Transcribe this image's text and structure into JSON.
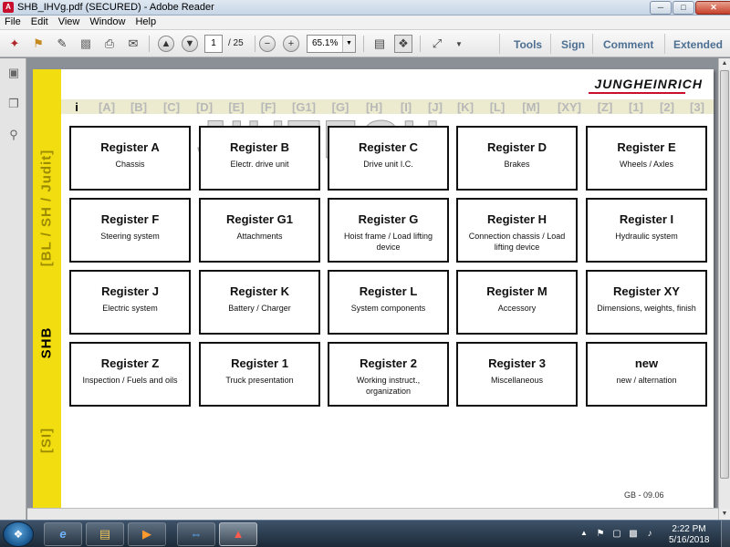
{
  "window": {
    "title": "SHB_IHVg.pdf (SECURED) - Adobe Reader",
    "controls": [
      "minimize",
      "maximize",
      "close"
    ]
  },
  "menu": [
    "File",
    "Edit",
    "View",
    "Window",
    "Help"
  ],
  "toolbar": {
    "page_current": "1",
    "page_total": "/ 25",
    "zoom": "65.1%",
    "links": [
      "Tools",
      "Sign",
      "Comment",
      "Extended"
    ]
  },
  "document": {
    "brand": "JUNGHEINRICH",
    "watermark": "JIUTECH",
    "side_labels": [
      "[BL / SH / Judit]",
      "SHB",
      "[SI]"
    ],
    "index_tabs": [
      "i",
      "[A]",
      "[B]",
      "[C]",
      "[D]",
      "[E]",
      "[F]",
      "[G1]",
      "[G]",
      "[H]",
      "[I]",
      "[J]",
      "[K]",
      "[L]",
      "[M]",
      "[XY]",
      "[Z]",
      "[1]",
      "[2]",
      "[3]"
    ],
    "registers": [
      {
        "name": "Register A",
        "desc": "Chassis"
      },
      {
        "name": "Register B",
        "desc": "Electr. drive unit"
      },
      {
        "name": "Register C",
        "desc": "Drive unit I.C."
      },
      {
        "name": "Register D",
        "desc": "Brakes"
      },
      {
        "name": "Register E",
        "desc": "Wheels / Axles"
      },
      {
        "name": "Register F",
        "desc": "Steering system"
      },
      {
        "name": "Register G1",
        "desc": "Attachments"
      },
      {
        "name": "Register G",
        "desc": "Hoist frame / Load lifting device"
      },
      {
        "name": "Register H",
        "desc": "Connection chassis / Load lifting device"
      },
      {
        "name": "Register I",
        "desc": "Hydraulic system"
      },
      {
        "name": "Register J",
        "desc": "Electric system"
      },
      {
        "name": "Register K",
        "desc": "Battery / Charger"
      },
      {
        "name": "Register L",
        "desc": "System components"
      },
      {
        "name": "Register M",
        "desc": "Accessory"
      },
      {
        "name": "Register XY",
        "desc": "Dimensions, weights, finish"
      },
      {
        "name": "Register Z",
        "desc": "Inspection / Fuels and oils"
      },
      {
        "name": "Register 1",
        "desc": "Truck presentation"
      },
      {
        "name": "Register 2",
        "desc": "Working instruct., organization"
      },
      {
        "name": "Register 3",
        "desc": "Miscellaneous"
      },
      {
        "name": "new",
        "desc": "new / alternation"
      }
    ],
    "footer": "GB - 09.06"
  },
  "taskbar": {
    "time": "2:22 PM",
    "date": "5/16/2018"
  },
  "colors": {
    "yellow_bar": "#f2dd10",
    "brand_red": "#c8102e",
    "toolbar_link": "#4d6f92"
  }
}
